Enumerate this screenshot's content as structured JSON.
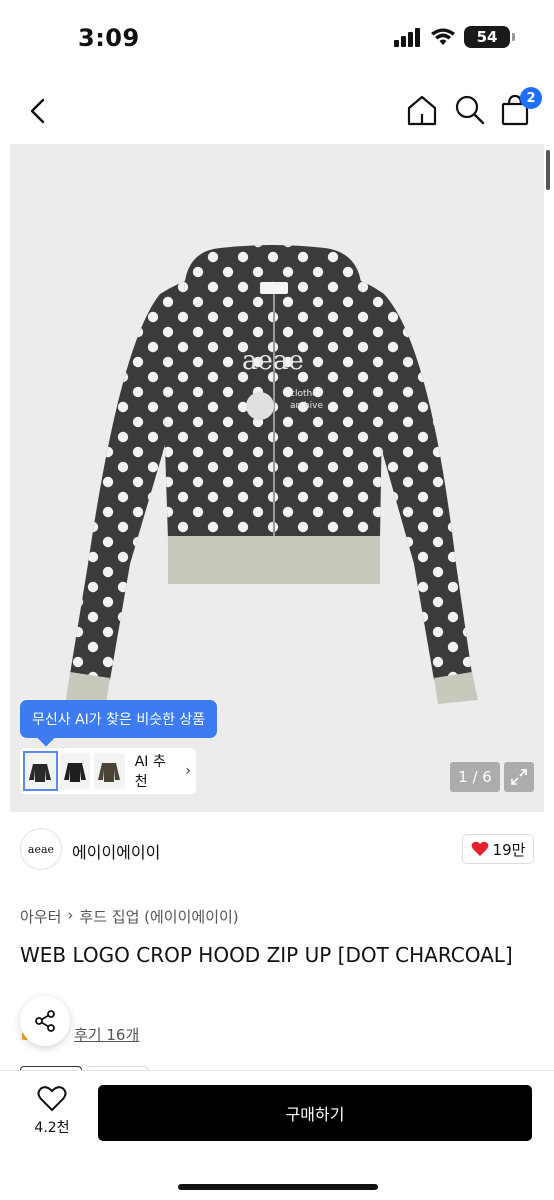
{
  "status_bar": {
    "time": "3:09",
    "battery": "54"
  },
  "nav": {
    "cart_count": "2",
    "icons": [
      "chevron-left-icon",
      "home-icon",
      "search-icon",
      "shopping-bag-icon"
    ]
  },
  "gallery": {
    "ai_tooltip": "무신사 AI가 찾은 비슷한 상품",
    "ai_button_label": "AI 추천",
    "page_counter": "1 / 6",
    "image_logo_text": "aeae"
  },
  "brand": {
    "logo_text": "aeae",
    "name": "에이이에이이",
    "like_count": "19만"
  },
  "product": {
    "breadcrumb": [
      "아우터",
      "후드 집업 (에이이에이이)"
    ],
    "title": "WEB LOGO CROP HOOD ZIP UP [DOT CHARCOAL]",
    "review_text": "후기 16개"
  },
  "bottom_bar": {
    "wish_count": "4.2천",
    "buy_label": "구매하기"
  },
  "colors": {
    "accent_blue": "#3c7cf0",
    "heart_red": "#e8202e",
    "hoodie_charcoal": "#3a3b3d",
    "rib_beige": "#c9c8bd"
  }
}
